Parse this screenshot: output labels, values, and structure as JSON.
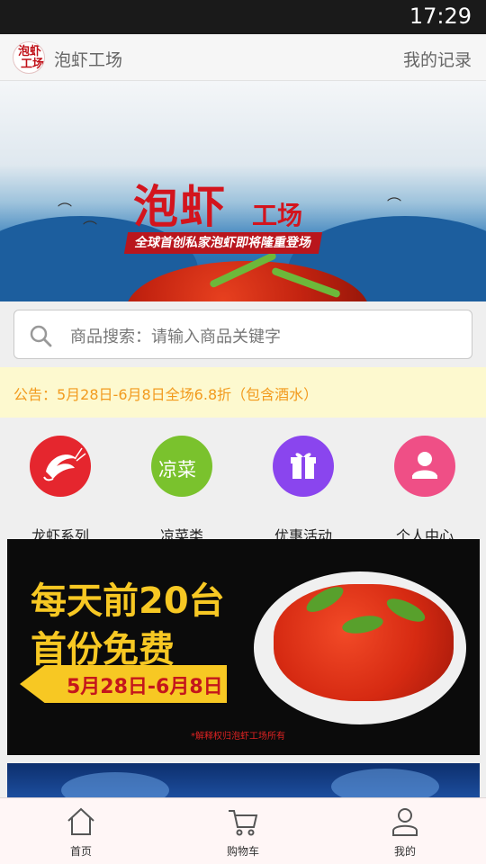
{
  "status_bar": {
    "time": "17:29"
  },
  "app_bar": {
    "logo_line1": "泡虾",
    "logo_line2": "工场",
    "title": "泡虾工场",
    "record_label": "我的记录"
  },
  "banner": {
    "title_big": "泡虾",
    "title_small": "工场",
    "slogan": "全球首创私家泡虾即将隆重登场"
  },
  "search": {
    "placeholder": "商品搜索：请输入商品关键字"
  },
  "notice": {
    "text": "公告：5月28日-6月8日全场6.8折（包含酒水）"
  },
  "categories": [
    {
      "label": "龙虾系列",
      "color": "#e5262e",
      "icon": "crayfish-icon"
    },
    {
      "label": "凉菜类",
      "color": "#7ac22d",
      "icon": "cold-dish-icon",
      "icon_text": "凉菜"
    },
    {
      "label": "优惠活动",
      "color": "#8a45ee",
      "icon": "gift-icon"
    },
    {
      "label": "个人中心",
      "color": "#ef4f86",
      "icon": "user-icon"
    }
  ],
  "promo": {
    "line1": "每天前20台",
    "line2": "首份免费",
    "date": "5月28日-6月8日",
    "note": "*解释权归泡虾工场所有"
  },
  "tab_bar": [
    {
      "label": "首页",
      "icon": "home-icon"
    },
    {
      "label": "购物车",
      "icon": "cart-icon"
    },
    {
      "label": "我的",
      "icon": "user-icon"
    }
  ]
}
